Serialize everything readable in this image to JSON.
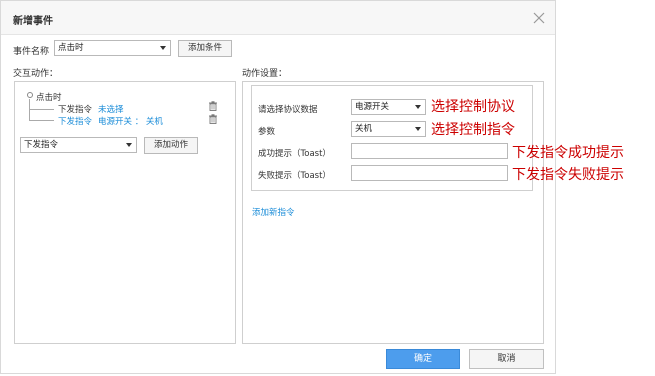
{
  "dialog": {
    "title": "新增事件",
    "event_name_label": "事件名称",
    "event_select_value": "点击时",
    "add_condition_label": "添加条件",
    "interaction_label": "交互动作：",
    "action_settings_label": "动作设置：",
    "confirm_label": "确定",
    "cancel_label": "取消"
  },
  "tree": {
    "root": "点击时",
    "rows": [
      {
        "cmd": "下发指令",
        "value": "未选择"
      },
      {
        "cmd": "下发指令",
        "value": "电源开关 ： 关机"
      }
    ]
  },
  "action_bar": {
    "select_value": "下发指令",
    "add_action_label": "添加动作"
  },
  "settings": {
    "protocol_label": "请选择协议数据",
    "protocol_value": "电源开关",
    "param_label": "参数",
    "param_value": "关机",
    "success_label": "成功提示（Toast）",
    "fail_label": "失败提示（Toast）",
    "add_command_label": "添加新指令"
  },
  "annotations": {
    "protocol_note": "选择控制协议",
    "param_note": "选择控制指令",
    "success_note": "下发指令成功提示",
    "fail_note": "下发指令失败提示"
  }
}
